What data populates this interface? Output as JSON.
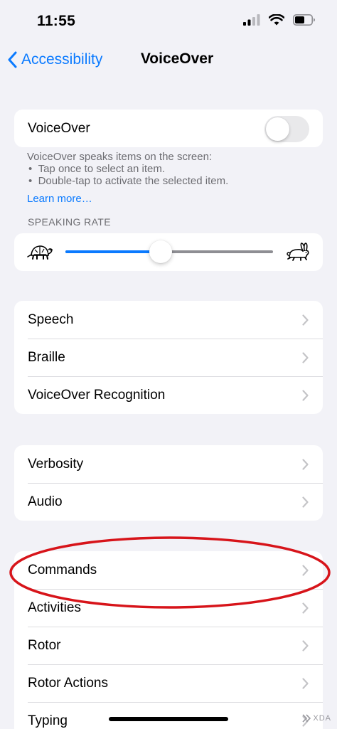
{
  "status_bar": {
    "time": "11:55"
  },
  "nav": {
    "back_label": "Accessibility",
    "title": "VoiceOver"
  },
  "voiceover": {
    "label": "VoiceOver",
    "toggle_on": false,
    "description": "VoiceOver speaks items on the screen:",
    "bullets": [
      "Tap once to select an item.",
      "Double-tap to activate the selected item."
    ],
    "learn_more": "Learn more…"
  },
  "speaking_rate": {
    "header": "SPEAKING RATE",
    "value_fraction": 0.46
  },
  "groups": [
    [
      "Speech",
      "Braille",
      "VoiceOver Recognition"
    ],
    [
      "Verbosity",
      "Audio"
    ],
    [
      "Commands",
      "Activities",
      "Rotor",
      "Rotor Actions",
      "Typing"
    ]
  ],
  "annotation": {
    "highlighted_item": "Commands",
    "color": "#d7141a"
  },
  "watermark": "XDA",
  "colors": {
    "accent": "#0a7aff",
    "background": "#f2f2f7",
    "secondary_text": "#6d6d72"
  }
}
